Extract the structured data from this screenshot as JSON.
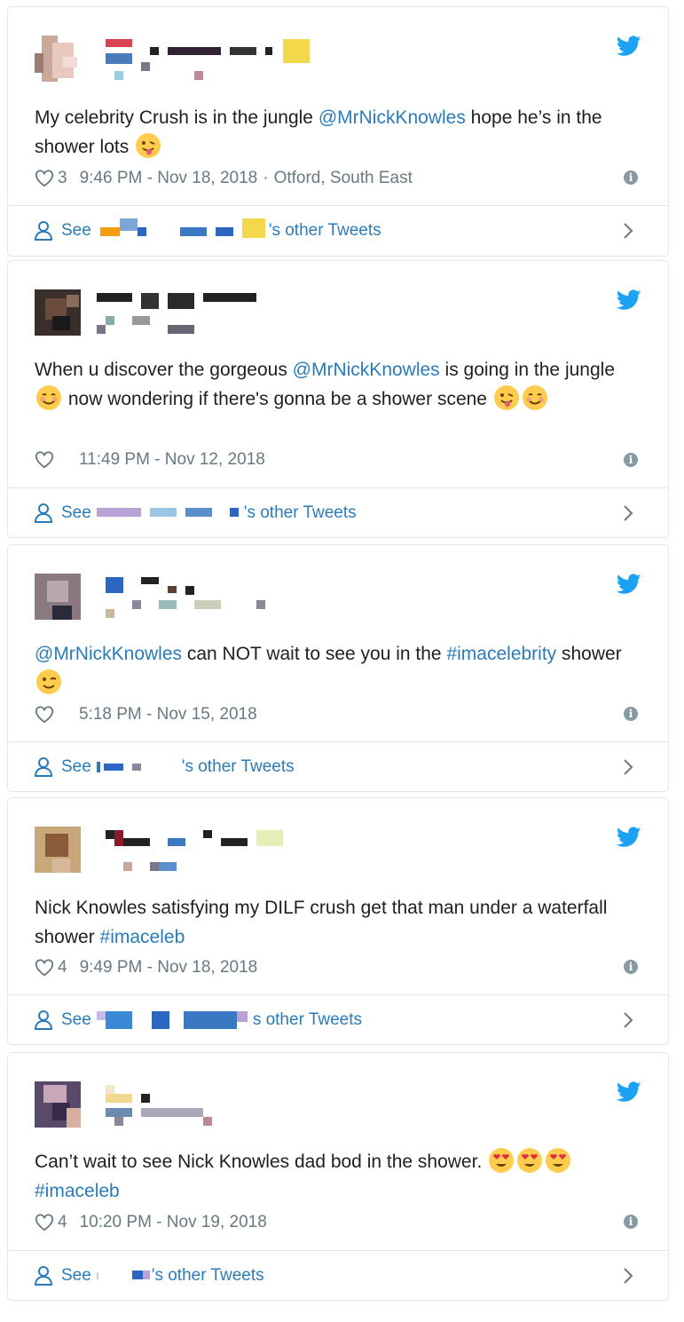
{
  "tweets": [
    {
      "text_before": "My celebrity Crush is in the jungle ",
      "mention": "@MrNickKnowles",
      "text_after": " hope he’s in the shower lots",
      "likes": "3",
      "time": "9:46 PM - Nov 18, 2018",
      "location_sep": "·",
      "location": "Otford, South East",
      "see": "See",
      "other": "'s other Tweets"
    },
    {
      "text_before": "When u discover the gorgeous ",
      "mention": "@MrNickKnowles",
      "text_after": " is going in the jungle ",
      "text_after2": " now wondering if there's gonna be a shower scene",
      "likes": "",
      "time": "11:49 PM - Nov 12, 2018",
      "see": "See",
      "other": "'s other Tweets"
    },
    {
      "mention": "@MrNickKnowles",
      "text_after": " can NOT wait to see you in the ",
      "hashtag": "#imacelebrity",
      "text_after2": " shower ",
      "likes": "",
      "time": "5:18 PM - Nov 15, 2018",
      "see": "See",
      "other": "'s other Tweets"
    },
    {
      "text_before": "Nick Knowles satisfying my DILF crush get that man under a waterfall shower ",
      "hashtag": "#imaceleb",
      "likes": "4",
      "time": "9:49 PM - Nov 18, 2018",
      "see": "See",
      "other": "s other Tweets"
    },
    {
      "text_before": "Can’t wait to see Nick Knowles dad bod in the shower. ",
      "hashtag": "#imaceleb",
      "likes": "4",
      "time": "10:20 PM - Nov 19, 2018",
      "see": "See",
      "other": "'s other Tweets"
    }
  ],
  "colors": {
    "link": "#2b7bb9",
    "meta": "#697882",
    "border": "#e1e8ed"
  },
  "icons": {
    "bird": "twitter-bird-icon",
    "heart": "heart-icon",
    "info": "info-icon",
    "user": "user-icon",
    "chevron": "chevron-right-icon"
  }
}
